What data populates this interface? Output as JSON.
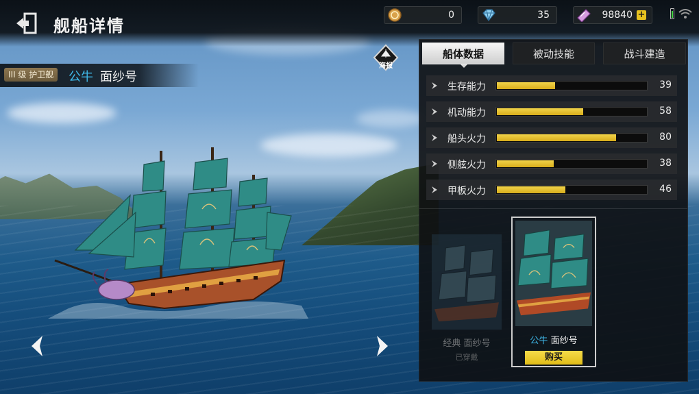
{
  "header": {
    "title": "舰船详情",
    "resources": [
      {
        "name": "coin",
        "icon": "coin-icon",
        "value": "0"
      },
      {
        "name": "diamond",
        "icon": "diamond-icon",
        "value": "35"
      },
      {
        "name": "ticket",
        "icon": "ticket-icon",
        "value": "98840"
      }
    ]
  },
  "ship": {
    "class_badge": "III 级 护卫舰",
    "skin_prefix": "公牛",
    "name": "面纱号"
  },
  "poster": {
    "label": "海报"
  },
  "tabs": [
    {
      "label": "船体数据",
      "active": true
    },
    {
      "label": "被动技能",
      "active": false
    },
    {
      "label": "战斗建造",
      "active": false
    }
  ],
  "stats": [
    {
      "label": "生存能力",
      "value": 39
    },
    {
      "label": "机动能力",
      "value": 58
    },
    {
      "label": "船头火力",
      "value": 80
    },
    {
      "label": "侧舷火力",
      "value": 38
    },
    {
      "label": "甲板火力",
      "value": 46
    }
  ],
  "stat_max": 100,
  "skins": {
    "classic": {
      "name": "经典 面纱号",
      "status": "已穿戴"
    },
    "bull": {
      "prefix": "公牛",
      "name": "面纱号",
      "button": "购买"
    }
  },
  "colors": {
    "accent_yellow": "#e8c31f",
    "accent_blue": "#3fb8e8"
  }
}
